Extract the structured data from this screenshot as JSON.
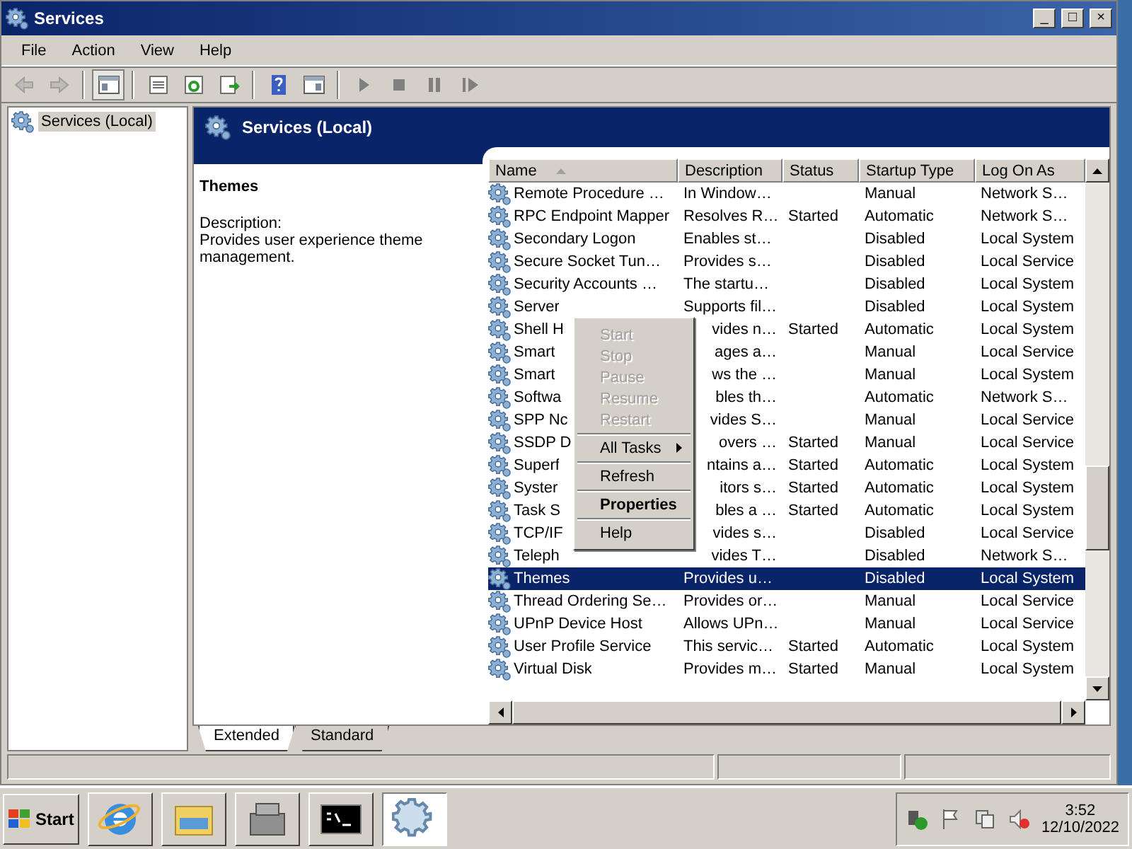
{
  "window": {
    "title": "Services",
    "controls": [
      "_",
      "□",
      "×"
    ]
  },
  "menu_bar": [
    "File",
    "Action",
    "View",
    "Help"
  ],
  "toolbar": {
    "buttons": [
      {
        "kind": "back",
        "disabled": true
      },
      {
        "kind": "forward",
        "disabled": true
      },
      {
        "kind": "sep"
      },
      {
        "kind": "tree",
        "selected": true
      },
      {
        "kind": "sep"
      },
      {
        "kind": "properties"
      },
      {
        "kind": "refresh"
      },
      {
        "kind": "export"
      },
      {
        "kind": "sep"
      },
      {
        "kind": "help"
      },
      {
        "kind": "panel"
      },
      {
        "kind": "sep"
      },
      {
        "kind": "play"
      },
      {
        "kind": "stop"
      },
      {
        "kind": "pause"
      },
      {
        "kind": "resume"
      }
    ]
  },
  "tree": {
    "items": [
      {
        "label": "Services (Local)",
        "selected": true
      }
    ]
  },
  "header": {
    "title": "Services (Local)"
  },
  "details": {
    "title": "Themes",
    "description_label": "Description:",
    "description": "Provides user experience theme management."
  },
  "table": {
    "columns": [
      {
        "label": "Name",
        "sorted": true
      },
      {
        "label": "Description",
        "sorted": false
      },
      {
        "label": "Status",
        "sorted": false
      },
      {
        "label": "Startup Type",
        "sorted": false
      },
      {
        "label": "Log On As",
        "sorted": false
      }
    ],
    "rows": [
      {
        "cells": [
          "Remote Procedure …",
          "In Window…",
          "",
          "Manual",
          "Network S…"
        ],
        "selected": false,
        "obscured": false
      },
      {
        "cells": [
          "RPC Endpoint Mapper",
          "Resolves R…",
          "Started",
          "Automatic",
          "Network S…"
        ],
        "selected": false,
        "obscured": false
      },
      {
        "cells": [
          "Secondary Logon",
          "Enables st…",
          "",
          "Disabled",
          "Local System"
        ],
        "selected": false,
        "obscured": false
      },
      {
        "cells": [
          "Secure Socket Tun…",
          "Provides s…",
          "",
          "Disabled",
          "Local Service"
        ],
        "selected": false,
        "obscured": false
      },
      {
        "cells": [
          "Security Accounts …",
          "The startu…",
          "",
          "Disabled",
          "Local System"
        ],
        "selected": false,
        "obscured": false
      },
      {
        "cells": [
          "Server",
          "Supports fil…",
          "",
          "Disabled",
          "Local System"
        ],
        "selected": false,
        "obscured": false
      },
      {
        "cells": [
          "Shell H",
          "vides n…",
          "Started",
          "Automatic",
          "Local System"
        ],
        "selected": false,
        "obscured": true
      },
      {
        "cells": [
          "Smart",
          "ages a…",
          "",
          "Manual",
          "Local Service"
        ],
        "selected": false,
        "obscured": true
      },
      {
        "cells": [
          "Smart",
          "ws the …",
          "",
          "Manual",
          "Local System"
        ],
        "selected": false,
        "obscured": true
      },
      {
        "cells": [
          "Softwa",
          "bles th…",
          "",
          "Automatic",
          "Network S…"
        ],
        "selected": false,
        "obscured": true
      },
      {
        "cells": [
          "SPP Nc",
          "vides S…",
          "",
          "Manual",
          "Local Service"
        ],
        "selected": false,
        "obscured": true
      },
      {
        "cells": [
          "SSDP D",
          "overs …",
          "Started",
          "Manual",
          "Local Service"
        ],
        "selected": false,
        "obscured": true
      },
      {
        "cells": [
          "Superf",
          "ntains a…",
          "Started",
          "Automatic",
          "Local System"
        ],
        "selected": false,
        "obscured": true
      },
      {
        "cells": [
          "Syster",
          "itors s…",
          "Started",
          "Automatic",
          "Local System"
        ],
        "selected": false,
        "obscured": true
      },
      {
        "cells": [
          "Task S",
          "bles a …",
          "Started",
          "Automatic",
          "Local System"
        ],
        "selected": false,
        "obscured": true
      },
      {
        "cells": [
          "TCP/IF",
          "vides s…",
          "",
          "Disabled",
          "Local Service"
        ],
        "selected": false,
        "obscured": true
      },
      {
        "cells": [
          "Teleph",
          "vides T…",
          "",
          "Disabled",
          "Network S…"
        ],
        "selected": false,
        "obscured": true
      },
      {
        "cells": [
          "Themes",
          "Provides u…",
          "",
          "Disabled",
          "Local System"
        ],
        "selected": true,
        "obscured": false
      },
      {
        "cells": [
          "Thread Ordering Se…",
          "Provides or…",
          "",
          "Manual",
          "Local Service"
        ],
        "selected": false,
        "obscured": false
      },
      {
        "cells": [
          "UPnP Device Host",
          "Allows UPn…",
          "",
          "Manual",
          "Local Service"
        ],
        "selected": false,
        "obscured": false
      },
      {
        "cells": [
          "User Profile Service",
          "This servic…",
          "Started",
          "Automatic",
          "Local System"
        ],
        "selected": false,
        "obscured": false
      },
      {
        "cells": [
          "Virtual Disk",
          "Provides m…",
          "Started",
          "Manual",
          "Local System"
        ],
        "selected": false,
        "obscured": false
      }
    ]
  },
  "context_menu": {
    "groups": [
      [
        {
          "label": "Start",
          "disabled": true
        },
        {
          "label": "Stop",
          "disabled": true
        },
        {
          "label": "Pause",
          "disabled": true
        },
        {
          "label": "Resume",
          "disabled": true
        },
        {
          "label": "Restart",
          "disabled": true
        }
      ],
      [
        {
          "label": "All Tasks",
          "submenu": true
        }
      ],
      [
        {
          "label": "Refresh"
        }
      ],
      [
        {
          "label": "Properties",
          "default": true
        }
      ],
      [
        {
          "label": "Help"
        }
      ]
    ]
  },
  "view_tabs": [
    {
      "label": "Extended",
      "selected": true
    },
    {
      "label": "Standard",
      "selected": false
    }
  ],
  "taskbar": {
    "start": "Start",
    "apps": [
      {
        "kind": "browser",
        "active": false
      },
      {
        "kind": "folder",
        "active": false
      },
      {
        "kind": "toolbox",
        "active": false
      },
      {
        "kind": "console",
        "active": false
      },
      {
        "kind": "gears",
        "active": true
      }
    ],
    "time": "3:52",
    "date": "12/10/2022"
  }
}
